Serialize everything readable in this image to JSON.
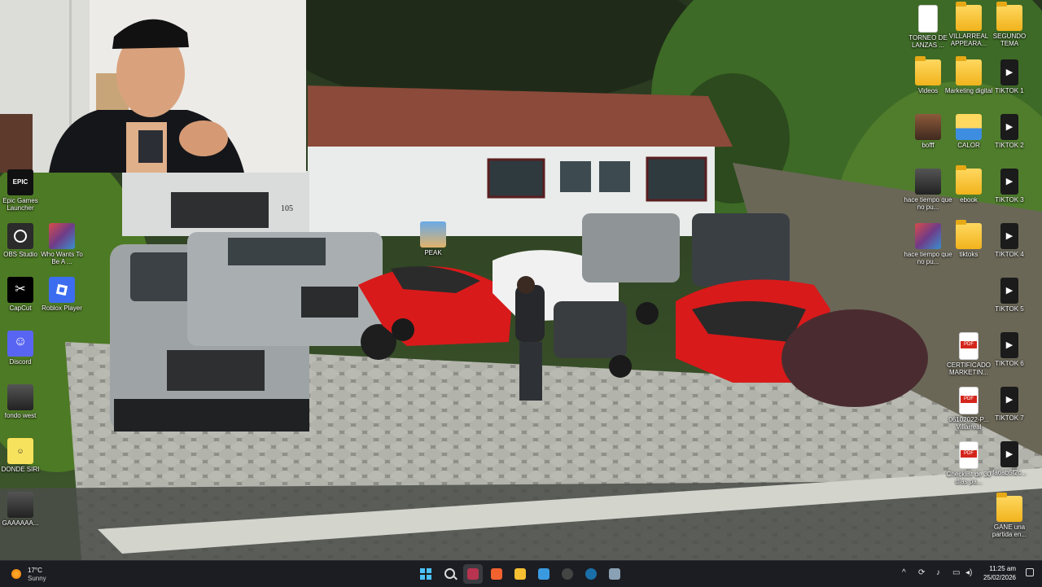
{
  "desktop": {
    "left_icons": [
      {
        "label": "Epic Games Launcher",
        "icon": "epic-games-icon"
      },
      {
        "label": "OBS Studio",
        "icon": "obs-icon"
      },
      {
        "label": "Who Wants To Be A ...",
        "icon": "game-thumbnail-icon"
      },
      {
        "label": "CapCut",
        "icon": "capcut-icon"
      },
      {
        "label": "Roblox Player",
        "icon": "roblox-icon"
      },
      {
        "label": "Discord",
        "icon": "discord-icon"
      },
      {
        "label": "fondo west",
        "icon": "image-file-icon"
      },
      {
        "label": "DONDE SIRI",
        "icon": "image-file-icon"
      },
      {
        "label": "GAAAAAA...",
        "icon": "image-file-icon"
      }
    ],
    "center_icon": {
      "label": "PEAK",
      "icon": "peak-game-icon"
    },
    "right_icons": [
      {
        "label": "TORNEO DE LANZAS ...",
        "icon": "document-icon"
      },
      {
        "label": "VILLARREAL APPEARA...",
        "icon": "folder-icon"
      },
      {
        "label": "SEGUNDO TEMA",
        "icon": "folder-icon"
      },
      {
        "label": "Videos",
        "icon": "folder-icon"
      },
      {
        "label": "Marketing digital",
        "icon": "folder-icon"
      },
      {
        "label": "TIKTOK 1",
        "icon": "video-file-icon"
      },
      {
        "label": "bofff",
        "icon": "image-file-icon"
      },
      {
        "label": "CALOR",
        "icon": "folder-icon"
      },
      {
        "label": "TIKTOK 2",
        "icon": "video-file-icon"
      },
      {
        "label": "hace tiempo que no pu...",
        "icon": "image-file-icon"
      },
      {
        "label": "ebook",
        "icon": "folder-icon"
      },
      {
        "label": "TIKTOK 3",
        "icon": "video-file-icon"
      },
      {
        "label": "hace tiempo que no pu...",
        "icon": "image-file-icon"
      },
      {
        "label": "tiktoks",
        "icon": "folder-icon"
      },
      {
        "label": "TIKTOK 4",
        "icon": "video-file-icon"
      },
      {
        "label": "TIKTOK 5",
        "icon": "video-file-icon"
      },
      {
        "label": "CERTIFICADO MARKETIN...",
        "icon": "pdf-icon"
      },
      {
        "label": "TIKTOK 6",
        "icon": "video-file-icon"
      },
      {
        "label": "06102022-P... Villarreal",
        "icon": "pdf-icon"
      },
      {
        "label": "TIKTOK 7",
        "icon": "video-file-icon"
      },
      {
        "label": "Checklist de 30 días pa...",
        "icon": "pdf-icon"
      },
      {
        "label": "fa6ab5f2c...",
        "icon": "video-file-icon"
      },
      {
        "label": "GANE una partida en...",
        "icon": "folder-icon"
      }
    ]
  },
  "webcam": {
    "description_icon": "webcam-feed"
  },
  "taskbar": {
    "weather": {
      "temp": "17°C",
      "condition": "Sunny",
      "icon": "sun-icon"
    },
    "apps": [
      {
        "name": "start",
        "icon": "windows-start-icon"
      },
      {
        "name": "search",
        "icon": "search-icon"
      },
      {
        "name": "active-app",
        "icon": "app-icon",
        "color": "#b8334f"
      },
      {
        "name": "brave",
        "icon": "brave-icon",
        "color": "#f2622e"
      },
      {
        "name": "explorer",
        "icon": "folder-icon",
        "color": "#f5c031"
      },
      {
        "name": "store",
        "icon": "store-icon",
        "color": "#3a9ae0"
      },
      {
        "name": "obs",
        "icon": "obs-icon",
        "color": "#444444"
      },
      {
        "name": "steam",
        "icon": "steam-icon",
        "color": "#1b6fa8"
      },
      {
        "name": "app",
        "icon": "app-icon",
        "color": "#8aa0b4"
      }
    ],
    "tray": {
      "chevron": "^"
    },
    "clock": {
      "time": "11:25 am",
      "date": "25/02/2026"
    }
  }
}
